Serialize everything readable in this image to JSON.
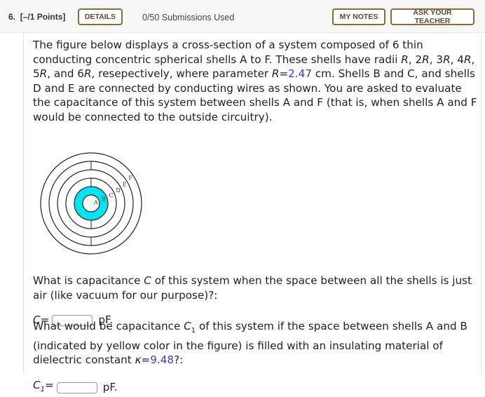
{
  "header": {
    "question_number": "6.",
    "points": "[–/1 Points]",
    "details_label": "DETAILS",
    "submissions": "0/50 Submissions Used",
    "my_notes_label": "MY NOTES",
    "ask_teacher_label": "ASK YOUR TEACHER"
  },
  "problem": {
    "intro_1": "The figure below displays a cross-section of a system composed of 6 thin conducting concentric spherical shells A to F. These shells have radii ",
    "radii": "R, 2R, 3R, 4R, 5R, and 6R",
    "intro_2": ", resepectively, where parameter ",
    "param_name": "R",
    "param_eq": "=",
    "R_value": "2.47",
    "intro_3": " cm. Shells B and C, and shells D and E are connected by conducting wires as shown. You are asked to evaluate the capacitance of this system between shells A and F (that is, when shells A and F would be connected to the outside circuitry)."
  },
  "figure": {
    "shell_labels": [
      "A",
      "B",
      "C",
      "D",
      "E",
      "F"
    ],
    "fill_color": "#00e5f0",
    "stroke_color": "#222222"
  },
  "question1": {
    "text_1": "What is capacitance ",
    "var": "C",
    "text_2": " of this system when the space between all the shells is just air (like vacuum for our purpose)?:",
    "answer_label": "C=",
    "answer_value": "",
    "unit": "pF."
  },
  "question2": {
    "text_1": "What would be capacitance ",
    "var": "C",
    "var_sub": "1",
    "text_2": " of this system if the space between shells A and B (indicated by yellow color in the figure) is filled with an insulating material of dielectric constant ",
    "kappa": "κ",
    "kappa_eq": "=",
    "kappa_value": "9.48",
    "text_3": "?:",
    "answer_label": "C",
    "answer_sub": "1",
    "answer_eq": "=",
    "answer_value": "",
    "unit": "pF."
  }
}
